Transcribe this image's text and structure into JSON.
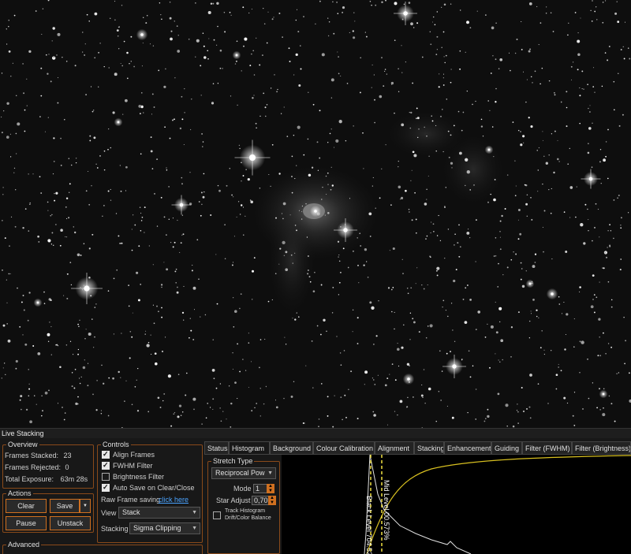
{
  "panel_title": "Live Stacking",
  "overview": {
    "title": "Overview",
    "frames_stacked_label": "Frames Stacked:",
    "frames_stacked_value": "23",
    "frames_rejected_label": "Frames Rejected:",
    "frames_rejected_value": "0",
    "total_exposure_label": "Total Exposure:",
    "total_exposure_value": "63m 28s"
  },
  "actions": {
    "title": "Actions",
    "clear": "Clear",
    "save": "Save",
    "pause": "Pause",
    "unstack": "Unstack"
  },
  "advanced": {
    "title": "Advanced"
  },
  "controls": {
    "title": "Controls",
    "align_frames": {
      "label": "Align Frames",
      "checked": true
    },
    "fwhm_filter": {
      "label": "FWHM Filter",
      "checked": true
    },
    "brightness_filter": {
      "label": "Brightness Filter",
      "checked": false
    },
    "auto_save": {
      "label": "Auto Save on Clear/Close",
      "checked": true
    },
    "raw_frame_label": "Raw Frame saving",
    "raw_frame_link": "click here",
    "view_label": "View",
    "view_value": "Stack",
    "stacking_label": "Stacking",
    "stacking_value": "Sigma Clipping"
  },
  "tabs": [
    "Status",
    "Histogram",
    "Background",
    "Colour Calibration",
    "Alignment",
    "Stacking",
    "Enhancement",
    "Guiding",
    "Filter (FWHM)",
    "Filter (Brightness)"
  ],
  "active_tab": 1,
  "stretch": {
    "title": "Stretch Type",
    "type_value": "Reciprocal Pow",
    "mode_label": "Mode",
    "mode_value": "1",
    "star_adjust_label": "Star Adjust",
    "star_adjust_value": "0,70",
    "track_label_1": "Track Histogram",
    "track_label_2": "Drift/Color Balance"
  },
  "histogram": {
    "black_level_label": "Black Level 704.52",
    "mid_level_label": "Mid Level 00.573%",
    "curve_color": "#d8c020",
    "marker_color": "#f0e040"
  },
  "colors": {
    "accent": "#d07020",
    "group_border": "#8a4a1a",
    "link": "#4aa3ff"
  }
}
